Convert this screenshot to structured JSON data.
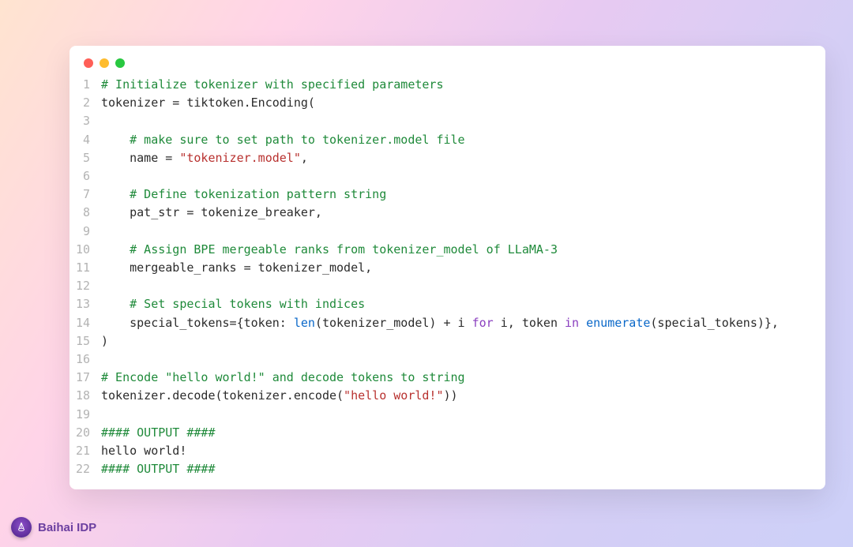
{
  "footer": {
    "brand": "Baihai IDP"
  },
  "code": {
    "lines": [
      {
        "n": 1,
        "tokens": [
          {
            "t": "# Initialize tokenizer with specified parameters",
            "c": "c-comment"
          }
        ]
      },
      {
        "n": 2,
        "tokens": [
          {
            "t": "tokenizer = tiktoken.Encoding(",
            "c": "c-plain"
          }
        ]
      },
      {
        "n": 3,
        "tokens": [
          {
            "t": "",
            "c": "c-plain"
          }
        ]
      },
      {
        "n": 4,
        "tokens": [
          {
            "t": "    ",
            "c": "c-plain"
          },
          {
            "t": "# make sure to set path to tokenizer.model file",
            "c": "c-comment"
          }
        ]
      },
      {
        "n": 5,
        "tokens": [
          {
            "t": "    name = ",
            "c": "c-plain"
          },
          {
            "t": "\"tokenizer.model\"",
            "c": "c-str"
          },
          {
            "t": ",",
            "c": "c-plain"
          }
        ]
      },
      {
        "n": 6,
        "tokens": [
          {
            "t": "",
            "c": "c-plain"
          }
        ]
      },
      {
        "n": 7,
        "tokens": [
          {
            "t": "    ",
            "c": "c-plain"
          },
          {
            "t": "# Define tokenization pattern string",
            "c": "c-comment"
          }
        ]
      },
      {
        "n": 8,
        "tokens": [
          {
            "t": "    pat_str = tokenize_breaker,",
            "c": "c-plain"
          }
        ]
      },
      {
        "n": 9,
        "tokens": [
          {
            "t": "",
            "c": "c-plain"
          }
        ]
      },
      {
        "n": 10,
        "tokens": [
          {
            "t": "    ",
            "c": "c-plain"
          },
          {
            "t": "# Assign BPE mergeable ranks from tokenizer_model of LLaMA-3",
            "c": "c-comment"
          }
        ]
      },
      {
        "n": 11,
        "tokens": [
          {
            "t": "    mergeable_ranks = tokenizer_model,",
            "c": "c-plain"
          }
        ]
      },
      {
        "n": 12,
        "tokens": [
          {
            "t": "",
            "c": "c-plain"
          }
        ]
      },
      {
        "n": 13,
        "tokens": [
          {
            "t": "    ",
            "c": "c-plain"
          },
          {
            "t": "# Set special tokens with indices",
            "c": "c-comment"
          }
        ]
      },
      {
        "n": 14,
        "tokens": [
          {
            "t": "    special_tokens={token: ",
            "c": "c-plain"
          },
          {
            "t": "len",
            "c": "c-builtin"
          },
          {
            "t": "(tokenizer_model) + i ",
            "c": "c-plain"
          },
          {
            "t": "for",
            "c": "c-kw"
          },
          {
            "t": " i, token ",
            "c": "c-plain"
          },
          {
            "t": "in",
            "c": "c-kw"
          },
          {
            "t": " ",
            "c": "c-plain"
          },
          {
            "t": "enumerate",
            "c": "c-builtin"
          },
          {
            "t": "(special_tokens)},",
            "c": "c-plain"
          }
        ]
      },
      {
        "n": 15,
        "tokens": [
          {
            "t": ")",
            "c": "c-plain"
          }
        ]
      },
      {
        "n": 16,
        "tokens": [
          {
            "t": "",
            "c": "c-plain"
          }
        ]
      },
      {
        "n": 17,
        "tokens": [
          {
            "t": "# Encode \"hello world!\" and decode tokens to string",
            "c": "c-comment"
          }
        ]
      },
      {
        "n": 18,
        "tokens": [
          {
            "t": "tokenizer.decode(tokenizer.encode(",
            "c": "c-plain"
          },
          {
            "t": "\"hello world!\"",
            "c": "c-str"
          },
          {
            "t": "))",
            "c": "c-plain"
          }
        ]
      },
      {
        "n": 19,
        "tokens": [
          {
            "t": "",
            "c": "c-plain"
          }
        ]
      },
      {
        "n": 20,
        "tokens": [
          {
            "t": "#### OUTPUT ####",
            "c": "c-comment"
          }
        ]
      },
      {
        "n": 21,
        "tokens": [
          {
            "t": "hello world!",
            "c": "c-plain"
          }
        ]
      },
      {
        "n": 22,
        "tokens": [
          {
            "t": "#### OUTPUT ####",
            "c": "c-comment"
          }
        ]
      }
    ]
  }
}
